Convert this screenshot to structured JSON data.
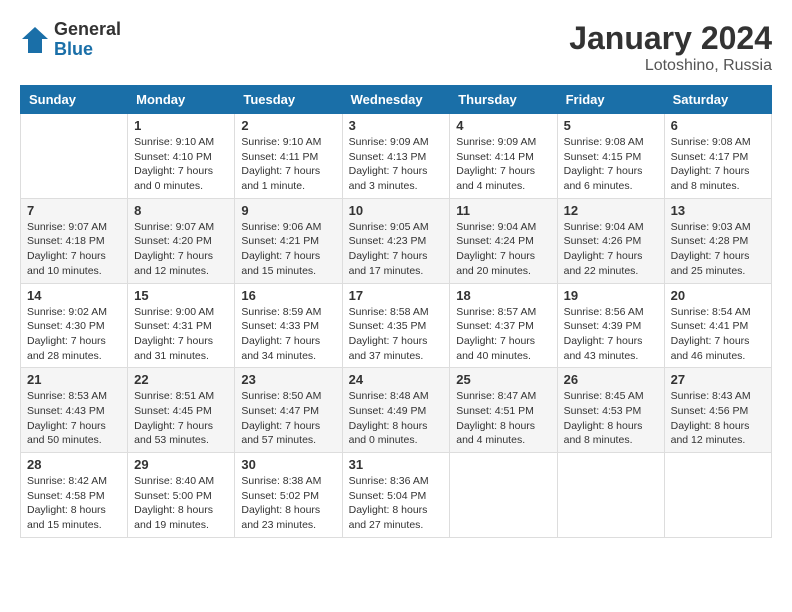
{
  "header": {
    "logo_general": "General",
    "logo_blue": "Blue",
    "month_year": "January 2024",
    "location": "Lotoshino, Russia"
  },
  "weekdays": [
    "Sunday",
    "Monday",
    "Tuesday",
    "Wednesday",
    "Thursday",
    "Friday",
    "Saturday"
  ],
  "weeks": [
    [
      {
        "day": "",
        "info": ""
      },
      {
        "day": "1",
        "info": "Sunrise: 9:10 AM\nSunset: 4:10 PM\nDaylight: 7 hours\nand 0 minutes."
      },
      {
        "day": "2",
        "info": "Sunrise: 9:10 AM\nSunset: 4:11 PM\nDaylight: 7 hours\nand 1 minute."
      },
      {
        "day": "3",
        "info": "Sunrise: 9:09 AM\nSunset: 4:13 PM\nDaylight: 7 hours\nand 3 minutes."
      },
      {
        "day": "4",
        "info": "Sunrise: 9:09 AM\nSunset: 4:14 PM\nDaylight: 7 hours\nand 4 minutes."
      },
      {
        "day": "5",
        "info": "Sunrise: 9:08 AM\nSunset: 4:15 PM\nDaylight: 7 hours\nand 6 minutes."
      },
      {
        "day": "6",
        "info": "Sunrise: 9:08 AM\nSunset: 4:17 PM\nDaylight: 7 hours\nand 8 minutes."
      }
    ],
    [
      {
        "day": "7",
        "info": "Sunrise: 9:07 AM\nSunset: 4:18 PM\nDaylight: 7 hours\nand 10 minutes."
      },
      {
        "day": "8",
        "info": "Sunrise: 9:07 AM\nSunset: 4:20 PM\nDaylight: 7 hours\nand 12 minutes."
      },
      {
        "day": "9",
        "info": "Sunrise: 9:06 AM\nSunset: 4:21 PM\nDaylight: 7 hours\nand 15 minutes."
      },
      {
        "day": "10",
        "info": "Sunrise: 9:05 AM\nSunset: 4:23 PM\nDaylight: 7 hours\nand 17 minutes."
      },
      {
        "day": "11",
        "info": "Sunrise: 9:04 AM\nSunset: 4:24 PM\nDaylight: 7 hours\nand 20 minutes."
      },
      {
        "day": "12",
        "info": "Sunrise: 9:04 AM\nSunset: 4:26 PM\nDaylight: 7 hours\nand 22 minutes."
      },
      {
        "day": "13",
        "info": "Sunrise: 9:03 AM\nSunset: 4:28 PM\nDaylight: 7 hours\nand 25 minutes."
      }
    ],
    [
      {
        "day": "14",
        "info": "Sunrise: 9:02 AM\nSunset: 4:30 PM\nDaylight: 7 hours\nand 28 minutes."
      },
      {
        "day": "15",
        "info": "Sunrise: 9:00 AM\nSunset: 4:31 PM\nDaylight: 7 hours\nand 31 minutes."
      },
      {
        "day": "16",
        "info": "Sunrise: 8:59 AM\nSunset: 4:33 PM\nDaylight: 7 hours\nand 34 minutes."
      },
      {
        "day": "17",
        "info": "Sunrise: 8:58 AM\nSunset: 4:35 PM\nDaylight: 7 hours\nand 37 minutes."
      },
      {
        "day": "18",
        "info": "Sunrise: 8:57 AM\nSunset: 4:37 PM\nDaylight: 7 hours\nand 40 minutes."
      },
      {
        "day": "19",
        "info": "Sunrise: 8:56 AM\nSunset: 4:39 PM\nDaylight: 7 hours\nand 43 minutes."
      },
      {
        "day": "20",
        "info": "Sunrise: 8:54 AM\nSunset: 4:41 PM\nDaylight: 7 hours\nand 46 minutes."
      }
    ],
    [
      {
        "day": "21",
        "info": "Sunrise: 8:53 AM\nSunset: 4:43 PM\nDaylight: 7 hours\nand 50 minutes."
      },
      {
        "day": "22",
        "info": "Sunrise: 8:51 AM\nSunset: 4:45 PM\nDaylight: 7 hours\nand 53 minutes."
      },
      {
        "day": "23",
        "info": "Sunrise: 8:50 AM\nSunset: 4:47 PM\nDaylight: 7 hours\nand 57 minutes."
      },
      {
        "day": "24",
        "info": "Sunrise: 8:48 AM\nSunset: 4:49 PM\nDaylight: 8 hours\nand 0 minutes."
      },
      {
        "day": "25",
        "info": "Sunrise: 8:47 AM\nSunset: 4:51 PM\nDaylight: 8 hours\nand 4 minutes."
      },
      {
        "day": "26",
        "info": "Sunrise: 8:45 AM\nSunset: 4:53 PM\nDaylight: 8 hours\nand 8 minutes."
      },
      {
        "day": "27",
        "info": "Sunrise: 8:43 AM\nSunset: 4:56 PM\nDaylight: 8 hours\nand 12 minutes."
      }
    ],
    [
      {
        "day": "28",
        "info": "Sunrise: 8:42 AM\nSunset: 4:58 PM\nDaylight: 8 hours\nand 15 minutes."
      },
      {
        "day": "29",
        "info": "Sunrise: 8:40 AM\nSunset: 5:00 PM\nDaylight: 8 hours\nand 19 minutes."
      },
      {
        "day": "30",
        "info": "Sunrise: 8:38 AM\nSunset: 5:02 PM\nDaylight: 8 hours\nand 23 minutes."
      },
      {
        "day": "31",
        "info": "Sunrise: 8:36 AM\nSunset: 5:04 PM\nDaylight: 8 hours\nand 27 minutes."
      },
      {
        "day": "",
        "info": ""
      },
      {
        "day": "",
        "info": ""
      },
      {
        "day": "",
        "info": ""
      }
    ]
  ]
}
